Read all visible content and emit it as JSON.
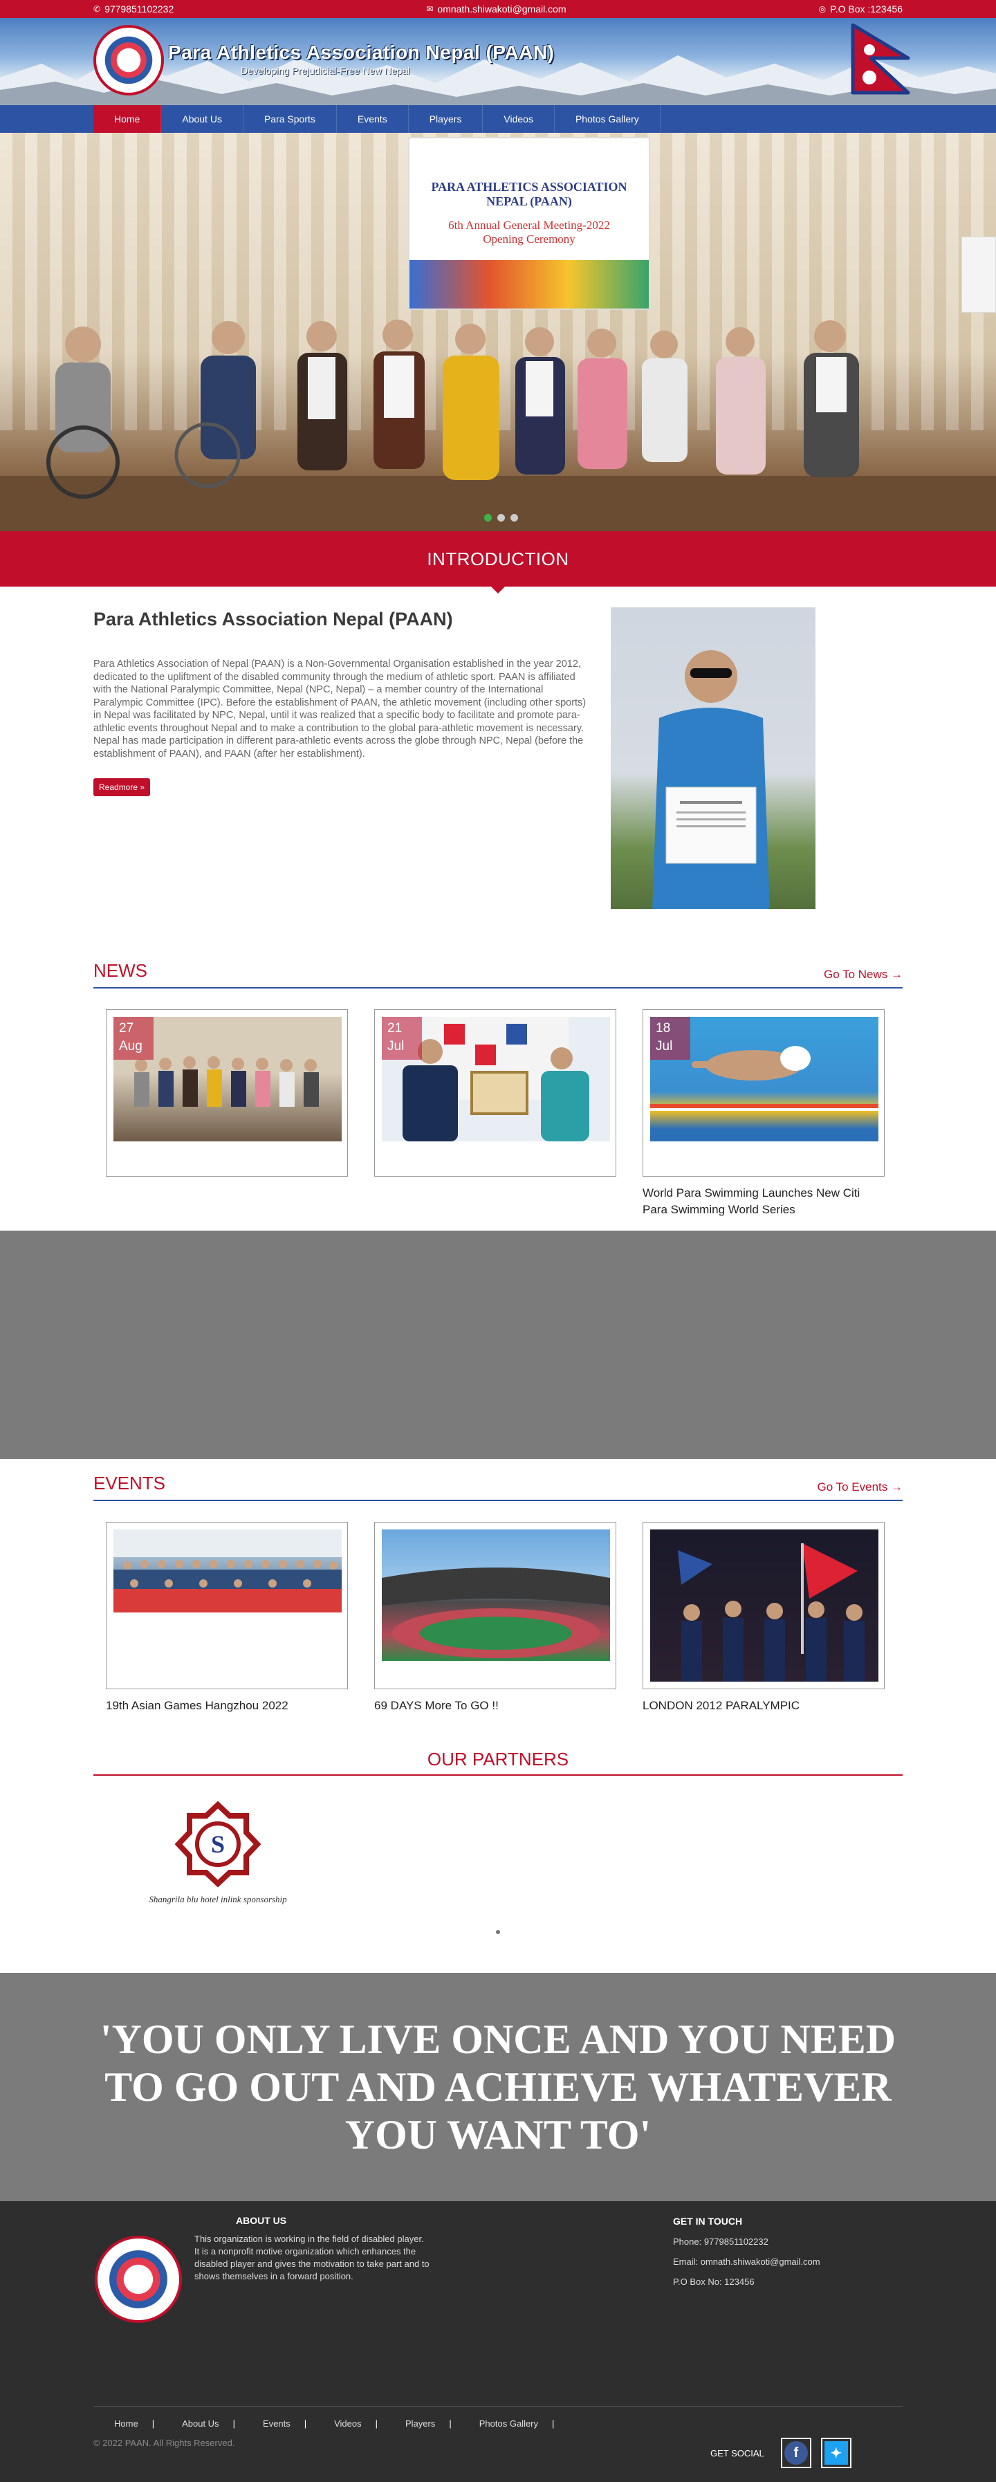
{
  "topbar": {
    "phone": "9779851102232",
    "email": "omnath.shiwakoti@gmail.com",
    "pobox": "P.O Box :123456"
  },
  "header": {
    "title": "Para Athletics Association Nepal (PAAN)",
    "tagline": "Developing Prejudicial-Free New Nepal"
  },
  "nav": {
    "items": [
      "Home",
      "About Us",
      "Para Sports",
      "Events",
      "Players",
      "Videos",
      "Photos Gallery"
    ],
    "active": "Home"
  },
  "hero": {
    "banner_line1": "PARA ATHLETICS ASSOCIATION NEPAL (PAAN)",
    "banner_line2": "6th Annual General Meeting-2022",
    "banner_line3": "Opening Ceremony"
  },
  "intro": {
    "band_title": "INTRODUCTION",
    "heading": "Para Athletics Association Nepal (PAAN)",
    "body": "Para Athletics Association of Nepal (PAAN) is a Non-Governmental Organisation established in the year 2012, dedicated to the upliftment of the disabled community through the medium of athletic sport. PAAN is affiliated with the National Paralympic Committee, Nepal (NPC, Nepal) – a member country of the International Paralympic Committee (IPC). Before the establishment of PAAN, the athletic movement (including other sports) in Nepal was facilitated by NPC, Nepal, until it was realized that a specific body to facilitate and promote para-athletic events throughout Nepal and to make a contribution to the global para-athletic movement is necessary. Nepal has made participation in different para-athletic events across the globe through NPC, Nepal (before the establishment of PAAN), and PAAN (after her establishment).",
    "readmore": "Readmore »"
  },
  "news": {
    "title": "NEWS",
    "goto": "Go To News →",
    "items": [
      {
        "day": "27",
        "month": "Aug",
        "caption": ""
      },
      {
        "day": "21",
        "month": "Jul",
        "caption": ""
      },
      {
        "day": "18",
        "month": "Jul",
        "caption": "World Para Swimming Launches New Citi Para Swimming World Series"
      }
    ]
  },
  "events": {
    "title": "EVENTS",
    "goto": "Go To Events →",
    "items": [
      {
        "caption": "19th Asian Games Hangzhou 2022"
      },
      {
        "caption": "69 DAYS More To GO !!"
      },
      {
        "caption": "LONDON 2012 PARALYMPIC"
      }
    ]
  },
  "partners": {
    "title": "OUR PARTNERS",
    "logo_caption": "Shangrila blu hotel inlink sponsorship"
  },
  "quote": {
    "text": "'YOU ONLY LIVE ONCE AND YOU NEED TO GO OUT AND ACHIEVE WHATEVER YOU WANT TO'"
  },
  "footer": {
    "about_title": "ABOUT US",
    "about_text": "This organization is working in the field of disabled player. It is a nonprofit motive organization which enhances the disabled player and gives the motivation to take part and to shows themselves in a forward position.",
    "contact_title": "GET IN TOUCH",
    "phone": "Phone: 9779851102232",
    "email": "Email: omnath.shiwakoti@gmail.com",
    "pobox": "P.O Box No: 123456",
    "nav": [
      "Home",
      "About Us",
      "Events",
      "Videos",
      "Players",
      "Photos Gallery"
    ],
    "copyright": "© 2022 PAAN. All Rights Reserved.",
    "social_label": "GET SOCIAL"
  },
  "colors": {
    "brand_red": "#c10e2a",
    "nav_blue": "#2d54a4",
    "footer_bg": "#2e2e2e",
    "band_gray": "#7b7b7b"
  }
}
